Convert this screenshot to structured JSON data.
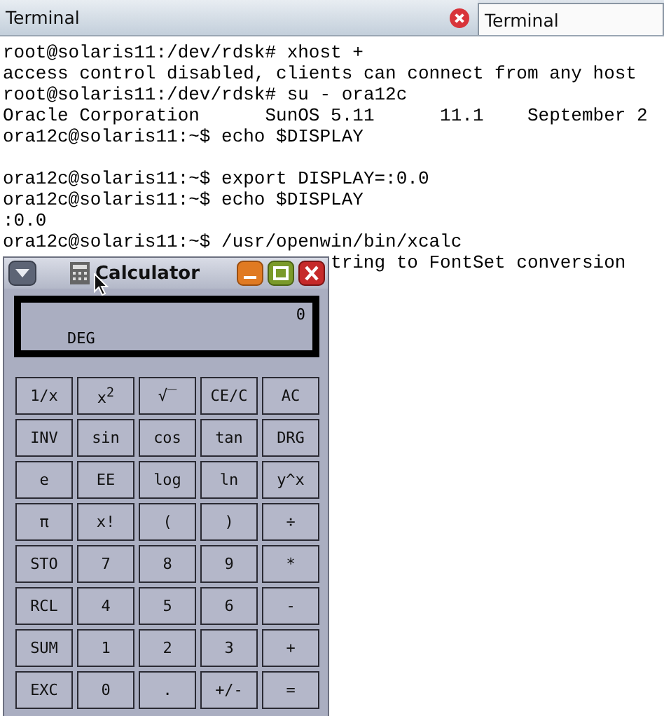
{
  "tabs": [
    {
      "label": "Terminal",
      "selected": true,
      "closable": true
    },
    {
      "label": "Terminal",
      "selected": false,
      "closable": false
    }
  ],
  "terminal_blocks": [
    [
      "root@solaris11:/dev/rdsk# xhost +",
      "access control disabled, clients can connect from any host",
      "root@solaris11:/dev/rdsk# su - ora12c",
      "Oracle Corporation      SunOS 5.11      11.1    September 2",
      "ora12c@solaris11:~$ echo $DISPLAY"
    ],
    [
      "ora12c@solaris11:~$ export DISPLAY=:0.0",
      "ora12c@solaris11:~$ echo $DISPLAY",
      ":0.0",
      "ora12c@solaris11:~$ /usr/openwin/bin/xcalc"
    ]
  ],
  "terminal_partial_line": "tring to FontSet conversion",
  "calculator": {
    "title": "Calculator",
    "display": {
      "value": "0",
      "mode": "DEG"
    },
    "keys": [
      [
        "1/x",
        "x$^{2}$",
        "√‾",
        "CE/C",
        "AC"
      ],
      [
        "INV",
        "sin",
        "cos",
        "tan",
        "DRG"
      ],
      [
        "e",
        "EE",
        "log",
        "ln",
        "y^x"
      ],
      [
        "π",
        "x!",
        "(",
        ")",
        "÷"
      ],
      [
        "STO",
        "7",
        "8",
        "9",
        "*"
      ],
      [
        "RCL",
        "4",
        "5",
        "6",
        "-"
      ],
      [
        "SUM",
        "1",
        "2",
        "3",
        "+"
      ],
      [
        "EXC",
        "0",
        ".",
        "+/-",
        "="
      ]
    ]
  }
}
